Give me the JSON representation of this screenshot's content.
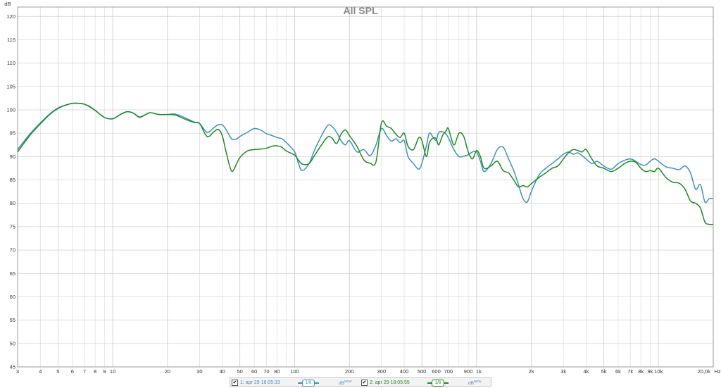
{
  "chart_data": {
    "type": "line",
    "title": "All SPL",
    "ylabel": "dB",
    "xlabel": "Hz",
    "xscale": "log",
    "xlim": [
      3,
      20000
    ],
    "ylim": [
      45,
      122
    ],
    "y_ticks": [
      45,
      50,
      55,
      60,
      65,
      70,
      75,
      80,
      85,
      90,
      95,
      100,
      105,
      110,
      115,
      120
    ],
    "x_ticks": [
      {
        "v": 3,
        "label": "3"
      },
      {
        "v": 4,
        "label": "4"
      },
      {
        "v": 5,
        "label": "5"
      },
      {
        "v": 6,
        "label": "6"
      },
      {
        "v": 7,
        "label": "7"
      },
      {
        "v": 8,
        "label": "8"
      },
      {
        "v": 9,
        "label": "9"
      },
      {
        "v": 10,
        "label": "10"
      },
      {
        "v": 20,
        "label": "20"
      },
      {
        "v": 30,
        "label": "30"
      },
      {
        "v": 40,
        "label": "40"
      },
      {
        "v": 50,
        "label": "50"
      },
      {
        "v": 60,
        "label": "60"
      },
      {
        "v": 70,
        "label": "70"
      },
      {
        "v": 80,
        "label": "80"
      },
      {
        "v": 100,
        "label": "100"
      },
      {
        "v": 200,
        "label": "200"
      },
      {
        "v": 300,
        "label": "300"
      },
      {
        "v": 400,
        "label": "400"
      },
      {
        "v": 500,
        "label": "500"
      },
      {
        "v": 600,
        "label": "600"
      },
      {
        "v": 700,
        "label": "700"
      },
      {
        "v": 900,
        "label": "900"
      },
      {
        "v": 1000,
        "label": "1k"
      },
      {
        "v": 2000,
        "label": "2k"
      },
      {
        "v": 3000,
        "label": "3k"
      },
      {
        "v": 4000,
        "label": "4k"
      },
      {
        "v": 5000,
        "label": "5k"
      },
      {
        "v": 6000,
        "label": "6k"
      },
      {
        "v": 7000,
        "label": "7k"
      },
      {
        "v": 8000,
        "label": "8k"
      },
      {
        "v": 9000,
        "label": "9k"
      },
      {
        "v": 10000,
        "label": "10k"
      },
      {
        "v": 20000,
        "label": "20,0k"
      }
    ],
    "grid": true,
    "legend_position": "bottom",
    "series": [
      {
        "name": "1: apr 29 18:05:33",
        "color": "#3d8fc4",
        "smoothing": "1/6",
        "x": [
          3,
          3.5,
          4,
          4.5,
          5,
          5.5,
          6,
          6.5,
          7,
          7.5,
          8,
          9,
          10,
          11,
          12,
          13,
          14,
          15,
          16,
          17,
          18,
          20,
          22,
          25,
          28,
          30,
          33,
          36,
          38,
          40,
          42,
          45,
          48,
          50,
          55,
          60,
          65,
          70,
          75,
          80,
          85,
          90,
          100,
          105,
          110,
          120,
          130,
          150,
          160,
          170,
          180,
          190,
          200,
          220,
          240,
          260,
          280,
          300,
          320,
          340,
          360,
          380,
          400,
          420,
          450,
          480,
          500,
          530,
          550,
          580,
          600,
          620,
          650,
          680,
          700,
          750,
          800,
          850,
          900,
          950,
          1000,
          1050,
          1100,
          1200,
          1300,
          1400,
          1500,
          1600,
          1700,
          1800,
          1900,
          2000,
          2200,
          2400,
          2600,
          2800,
          3000,
          3200,
          3400,
          3600,
          3800,
          4000,
          4300,
          4600,
          5000,
          5500,
          6000,
          6500,
          7000,
          7500,
          8000,
          8500,
          9000,
          9500,
          10000,
          11000,
          12000,
          13000,
          14000,
          15000,
          16000,
          17000,
          18000,
          19000,
          20000
        ],
        "y": [
          91.5,
          94.8,
          97.2,
          99.1,
          100.4,
          101.0,
          101.4,
          101.4,
          101.2,
          100.7,
          99.9,
          98.4,
          98.1,
          99.0,
          99.6,
          99.3,
          98.5,
          98.9,
          99.4,
          99.2,
          99.0,
          99.0,
          99.1,
          98.3,
          97.4,
          97.1,
          95.2,
          96.2,
          96.8,
          96.8,
          95.8,
          93.8,
          93.8,
          94.3,
          95.2,
          96.0,
          95.7,
          94.9,
          94.5,
          94.1,
          93.8,
          93.0,
          91.0,
          88.5,
          87.0,
          88.5,
          91.8,
          96.4,
          96.5,
          95.2,
          93.4,
          92.5,
          93.4,
          91.0,
          91.5,
          90.2,
          92.5,
          96.0,
          94.5,
          93.3,
          93.8,
          93.0,
          93.4,
          90.0,
          88.5,
          87.3,
          88.5,
          92.3,
          95.0,
          94.0,
          93.5,
          95.2,
          95.3,
          94.8,
          94.0,
          91.5,
          90.0,
          90.1,
          90.4,
          91.0,
          91.0,
          89.0,
          86.8,
          88.5,
          91.5,
          92.0,
          89.5,
          87.0,
          84.0,
          81.0,
          80.3,
          82.5,
          86.0,
          87.5,
          88.5,
          89.5,
          90.5,
          91.0,
          90.5,
          90.8,
          90.2,
          89.5,
          88.5,
          89.0,
          88.0,
          87.3,
          88.5,
          89.2,
          89.5,
          89.0,
          88.3,
          88.2,
          89.0,
          89.5,
          89.0,
          87.8,
          87.5,
          87.2,
          88.0,
          86.5,
          83.0,
          84.0,
          80.3,
          81.0,
          81.0
        ]
      },
      {
        "name": "2: apr 29 18:05:55",
        "color": "#1f8a1f",
        "smoothing": "1/6",
        "x": [
          3,
          3.5,
          4,
          4.5,
          5,
          5.5,
          6,
          6.5,
          7,
          7.5,
          8,
          9,
          10,
          11,
          12,
          13,
          14,
          15,
          16,
          17,
          18,
          20,
          22,
          25,
          28,
          30,
          33,
          36,
          38,
          40,
          42,
          45,
          48,
          50,
          55,
          60,
          65,
          70,
          75,
          80,
          85,
          90,
          100,
          105,
          110,
          120,
          130,
          150,
          160,
          170,
          180,
          190,
          200,
          220,
          240,
          260,
          280,
          300,
          320,
          340,
          360,
          380,
          400,
          420,
          450,
          480,
          500,
          530,
          550,
          580,
          600,
          620,
          650,
          680,
          700,
          750,
          800,
          850,
          900,
          950,
          1000,
          1050,
          1100,
          1200,
          1300,
          1400,
          1500,
          1600,
          1700,
          1800,
          1900,
          2000,
          2200,
          2400,
          2600,
          2800,
          3000,
          3200,
          3400,
          3600,
          3800,
          4000,
          4300,
          4600,
          5000,
          5500,
          6000,
          6500,
          7000,
          7500,
          8000,
          8500,
          9000,
          9500,
          10000,
          11000,
          12000,
          13000,
          14000,
          15000,
          16000,
          17000,
          18000,
          19000,
          20000
        ],
        "y": [
          91.0,
          94.5,
          97.0,
          99.0,
          100.3,
          101.0,
          101.4,
          101.4,
          101.2,
          100.6,
          99.9,
          98.4,
          98.1,
          99.0,
          99.6,
          99.3,
          98.4,
          98.9,
          99.4,
          99.2,
          99.0,
          99.0,
          98.9,
          98.0,
          97.3,
          97.1,
          94.3,
          95.3,
          95.8,
          94.5,
          91.0,
          86.9,
          88.5,
          89.8,
          91.2,
          91.5,
          91.6,
          91.8,
          92.2,
          92.3,
          92.0,
          91.2,
          90.3,
          89.2,
          88.4,
          88.5,
          90.5,
          94.0,
          94.0,
          92.8,
          94.8,
          95.7,
          94.5,
          92.2,
          89.3,
          88.6,
          88.9,
          97.2,
          96.5,
          96.0,
          94.8,
          94.1,
          95.0,
          92.2,
          91.5,
          94.0,
          93.5,
          90.0,
          93.0,
          94.0,
          93.8,
          92.5,
          94.5,
          95.5,
          96.0,
          92.5,
          95.0,
          94.3,
          91.0,
          89.5,
          91.3,
          90.0,
          87.5,
          88.0,
          89.0,
          87.0,
          86.5,
          85.0,
          83.5,
          83.8,
          83.5,
          84.2,
          85.5,
          86.5,
          87.5,
          88.0,
          89.5,
          90.8,
          91.5,
          91.3,
          91.0,
          91.5,
          89.5,
          88.0,
          87.5,
          86.8,
          87.5,
          88.5,
          89.0,
          88.8,
          87.5,
          86.8,
          87.0,
          86.8,
          87.5,
          85.5,
          84.5,
          84.3,
          83.0,
          80.5,
          80.0,
          79.0,
          76.0,
          75.5,
          75.5
        ]
      }
    ]
  },
  "legend": {
    "items": [
      {
        "label": "1: apr 29 18:05:33",
        "smoothing": "1/6",
        "db": "dB",
        "db_sup": "NEW",
        "color": "#3d8fc4",
        "checked": "✔"
      },
      {
        "label": "2: apr 29 18:05:55",
        "smoothing": "1/6",
        "db": "dB",
        "db_sup": "NEW",
        "color": "#1f8a1f",
        "checked": "✔"
      }
    ]
  }
}
